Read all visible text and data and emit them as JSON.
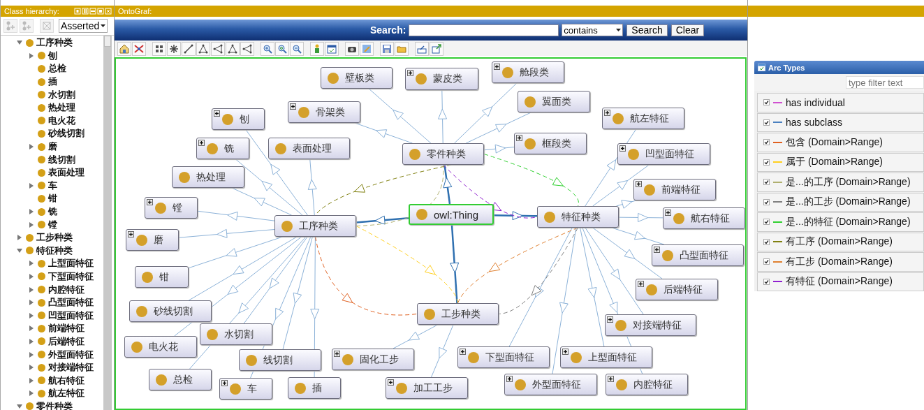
{
  "class_hierarchy": {
    "title": "Class hierarchy:",
    "mode": "Asserted",
    "tree": [
      {
        "label": "工序种类",
        "expanded": true,
        "children": [
          {
            "label": "刨",
            "expanded": false
          },
          {
            "label": "总检"
          },
          {
            "label": "插"
          },
          {
            "label": "水切割"
          },
          {
            "label": "热处理"
          },
          {
            "label": "电火花"
          },
          {
            "label": "砂线切割"
          },
          {
            "label": "磨",
            "expanded": false
          },
          {
            "label": "线切割"
          },
          {
            "label": "表面处理"
          },
          {
            "label": "车",
            "expanded": false
          },
          {
            "label": "钳"
          },
          {
            "label": "铣",
            "expanded": false
          },
          {
            "label": "镗",
            "expanded": false
          }
        ]
      },
      {
        "label": "工步种类",
        "expanded": false
      },
      {
        "label": "特征种类",
        "expanded": true,
        "children": [
          {
            "label": "上型面特征",
            "expanded": false
          },
          {
            "label": "下型面特征",
            "expanded": false
          },
          {
            "label": "内腔特征",
            "expanded": false
          },
          {
            "label": "凸型面特征",
            "expanded": false
          },
          {
            "label": "凹型面特征",
            "expanded": false
          },
          {
            "label": "前端特征",
            "expanded": false
          },
          {
            "label": "后端特征",
            "expanded": false
          },
          {
            "label": "外型面特征",
            "expanded": false
          },
          {
            "label": "对接端特征",
            "expanded": false
          },
          {
            "label": "航右特征",
            "expanded": false
          },
          {
            "label": "航左特征",
            "expanded": false
          }
        ]
      },
      {
        "label": "零件种类",
        "expanded": true
      }
    ]
  },
  "ontograf": {
    "title": "OntoGraf:",
    "search": {
      "label": "Search:",
      "match": "contains",
      "buttons": [
        "Search",
        "Clear"
      ]
    },
    "graph": {
      "root": {
        "label": "owl:Thing",
        "selected": true,
        "expandable": false,
        "children": [
          {
            "label": "零件种类",
            "selected": false,
            "expandable": false,
            "children": [
              {
                "label": "舱段类",
                "selected": false,
                "expandable": true
              },
              {
                "label": "壁板类",
                "selected": false,
                "expandable": false
              },
              {
                "label": "蒙皮类",
                "selected": false,
                "expandable": true
              },
              {
                "label": "翼面类",
                "selected": false,
                "expandable": false
              },
              {
                "label": "骨架类",
                "selected": false,
                "expandable": true
              },
              {
                "label": "框段类",
                "selected": false,
                "expandable": true
              }
            ]
          },
          {
            "label": "工序种类",
            "selected": false,
            "expandable": false,
            "children": [
              {
                "label": "刨",
                "selected": false,
                "expandable": true
              },
              {
                "label": "铣",
                "selected": false,
                "expandable": true
              },
              {
                "label": "表面处理",
                "selected": false,
                "expandable": false
              },
              {
                "label": "热处理",
                "selected": false,
                "expandable": false
              },
              {
                "label": "镗",
                "selected": false,
                "expandable": true
              },
              {
                "label": "磨",
                "selected": false,
                "expandable": true
              },
              {
                "label": "钳",
                "selected": false,
                "expandable": false
              },
              {
                "label": "砂线切割",
                "selected": false,
                "expandable": false
              },
              {
                "label": "水切割",
                "selected": false,
                "expandable": false
              },
              {
                "label": "电火花",
                "selected": false,
                "expandable": false
              },
              {
                "label": "线切割",
                "selected": false,
                "expandable": false
              },
              {
                "label": "总检",
                "selected": false,
                "expandable": false
              },
              {
                "label": "车",
                "selected": false,
                "expandable": true
              },
              {
                "label": "插",
                "selected": false,
                "expandable": false
              }
            ]
          },
          {
            "label": "工步种类",
            "selected": false,
            "expandable": false,
            "children": [
              {
                "label": "固化工步",
                "selected": false,
                "expandable": true
              },
              {
                "label": "加工工步",
                "selected": false,
                "expandable": true
              }
            ]
          },
          {
            "label": "特征种类",
            "selected": false,
            "expandable": false,
            "children": [
              {
                "label": "航左特征",
                "selected": false,
                "expandable": true
              },
              {
                "label": "凹型面特征",
                "selected": false,
                "expandable": true
              },
              {
                "label": "前端特征",
                "selected": false,
                "expandable": true
              },
              {
                "label": "航右特征",
                "selected": false,
                "expandable": true
              },
              {
                "label": "凸型面特征",
                "selected": false,
                "expandable": true
              },
              {
                "label": "后端特征",
                "selected": false,
                "expandable": true
              },
              {
                "label": "对接端特征",
                "selected": false,
                "expandable": true
              },
              {
                "label": "下型面特征",
                "selected": false,
                "expandable": true
              },
              {
                "label": "上型面特征",
                "selected": false,
                "expandable": true
              },
              {
                "label": "外型面特征",
                "selected": false,
                "expandable": true
              },
              {
                "label": "内腔特征",
                "selected": false,
                "expandable": true
              }
            ]
          }
        ]
      }
    }
  },
  "arc_types": {
    "title": "Arc Types",
    "filter": {
      "placeholder": "type filter text"
    },
    "items": [
      {
        "label": "has individual",
        "color": "#d050d0",
        "checked": true
      },
      {
        "label": "has subclass",
        "color": "#4a80c0",
        "checked": true
      },
      {
        "label": "包含 (Domain>Range)",
        "color": "#e06020",
        "checked": true
      },
      {
        "label": "属于 (Domain>Range)",
        "color": "#ffd020",
        "checked": true
      },
      {
        "label": "是...的工序 (Domain>Range)",
        "color": "#b0b070",
        "checked": true
      },
      {
        "label": "是...的工步 (Domain>Range)",
        "color": "#808080",
        "checked": true
      },
      {
        "label": "是...的特征 (Domain>Range)",
        "color": "#30d030",
        "checked": true
      },
      {
        "label": "有工序 (Domain>Range)",
        "color": "#808010",
        "checked": true
      },
      {
        "label": "有工步 (Domain>Range)",
        "color": "#e08030",
        "checked": true
      },
      {
        "label": "有特征 (Domain>Range)",
        "color": "#9020d0",
        "checked": true
      }
    ]
  }
}
